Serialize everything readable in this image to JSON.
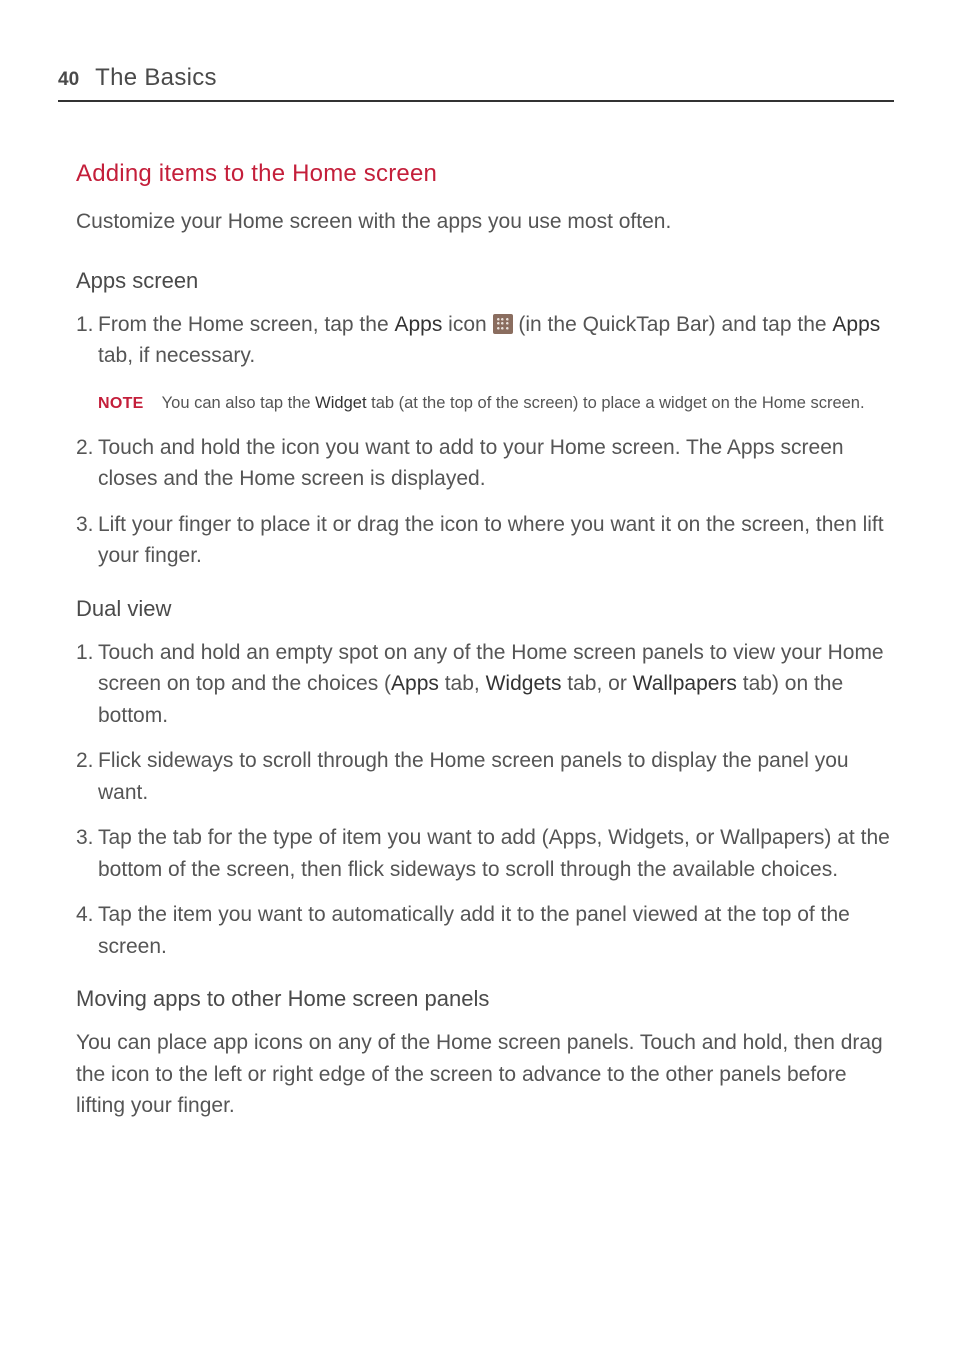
{
  "header": {
    "page_number": "40",
    "title": "The Basics"
  },
  "s1": {
    "title": "Adding items to the Home screen",
    "intro": "Customize your Home screen with the apps you use most often."
  },
  "s2": {
    "title": "Apps screen",
    "i1": {
      "num": "1.",
      "p1": "From the Home screen, tap the ",
      "e1": "Apps",
      "p2": " icon ",
      "p3": " (in the QuickTap Bar) and tap the ",
      "e2": "Apps",
      "p4": " tab, if necessary."
    },
    "note": {
      "label": "NOTE",
      "p1": "You can also tap the ",
      "e1": "Widget",
      "p2": " tab (at the top of the screen) to place a widget on the Home screen."
    },
    "i2": {
      "num": "2.",
      "text": "Touch and hold the icon you want to add to your Home screen. The Apps screen closes and the Home screen is displayed."
    },
    "i3": {
      "num": "3.",
      "text": "Lift your finger to place it or drag the icon to where you want it on the screen, then lift your finger."
    }
  },
  "s3": {
    "title": "Dual view",
    "i1": {
      "num": "1.",
      "p1": "Touch and hold an empty spot on any of the Home screen panels to view your Home screen on top and the choices (",
      "e1": "Apps",
      "p2": " tab, ",
      "e2": "Widgets",
      "p3": " tab, or ",
      "e3": "Wallpapers",
      "p4": " tab) on the bottom."
    },
    "i2": {
      "num": "2.",
      "text": "Flick sideways to scroll through the Home screen panels to display the panel you want."
    },
    "i3": {
      "num": "3.",
      "text": "Tap the tab for the type of item you want to add (Apps, Widgets, or Wallpapers) at the bottom of the screen, then flick sideways to scroll through the available choices."
    },
    "i4": {
      "num": "4.",
      "text": "Tap the item you want to automatically add it to the panel viewed at the top of the screen."
    }
  },
  "s4": {
    "title": "Moving apps to other Home screen panels",
    "text": "You can place app icons on any of the Home screen panels. Touch and hold, then drag the icon to the left or right edge of the screen to advance to the other panels before lifting your finger."
  }
}
